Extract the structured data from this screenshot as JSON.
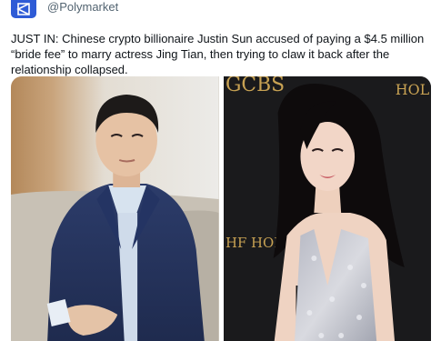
{
  "account": {
    "handle": "@Polymarket",
    "avatar_color": "#2e5bd6",
    "avatar_icon": "polymarket-logo-icon"
  },
  "tweet": {
    "text": "JUST IN: Chinese crypto billionaire Justin Sun accused of paying a $4.5 million “bride fee” to marry actress Jing Tian, then trying to claw it back after the relationship collapsed."
  },
  "media": {
    "left_photo": {
      "subject": "man in navy suit seated on couch",
      "background_color": "#d9d3c8"
    },
    "right_photo": {
      "subject": "woman in silver sequined dress at red carpet",
      "backdrop_text_top": "GCBS",
      "backdrop_text_right": "HOL FILM",
      "backdrop_text_left": "HF HOLLY FILM A",
      "background_color": "#1b1b1d"
    }
  }
}
